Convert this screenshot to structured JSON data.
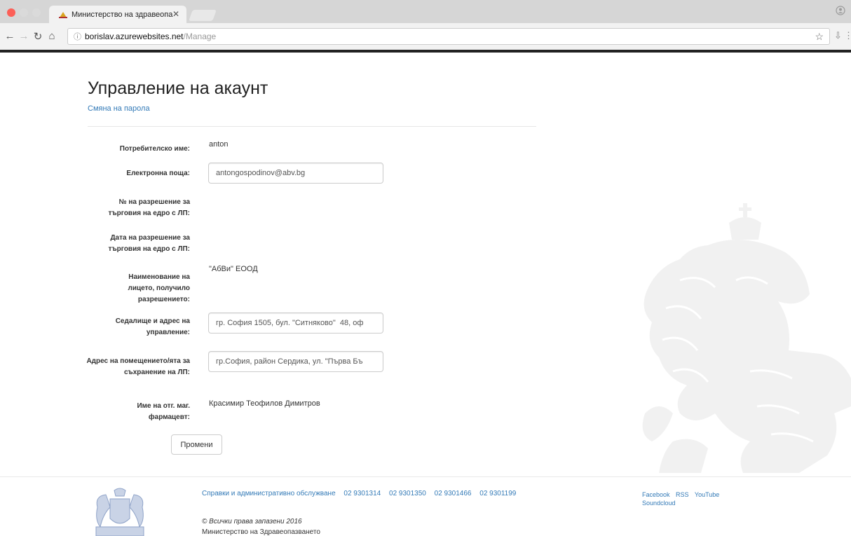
{
  "browser": {
    "tab_title": "Министерство на здравеопа",
    "url_host": "borislav.azurewebsites.net",
    "url_path": "/Manage"
  },
  "page": {
    "title": "Управление на акаунт",
    "change_password_link": "Смяна на парола"
  },
  "form": {
    "username_label": "Потребителско име:",
    "username_value": "anton",
    "email_label": "Електронна поща:",
    "email_value": "antongospodinov@abv.bg",
    "permit_no_label": "№ на разрешение за търговия на едро с ЛП:",
    "permit_date_label": "Дата на разрешение за търговия на едро с ЛП:",
    "entity_name_label": "Наименование на лицето, получило разрешението:",
    "entity_name_value": "\"АбВи\" ЕООД",
    "seat_address_label": "Седалище и адрес на управление:",
    "seat_address_value": "гр. София 1505, бул. \"Ситняково\"  48, оф",
    "storage_address_label": "Адрес на помещението/ята за съхранение на ЛП:",
    "storage_address_value": "гр.София, район Сердика, ул. \"Първа Бъ",
    "pharmacist_label": "Име на отг. маг. фармацевт:",
    "pharmacist_value": "Красимир Теофилов Димитров",
    "submit_label": "Промени"
  },
  "footer": {
    "info_links": [
      "Справки и административно обслужване",
      "02 9301314",
      "02 9301350",
      "02 9301466",
      "02 9301199"
    ],
    "copyright": "© Всички права запазени 2016",
    "ministry": "Министерство на Здравеопазването",
    "social": [
      "Facebook",
      "RSS",
      "YouTube",
      "Soundcloud"
    ]
  },
  "colors": {
    "link": "#337ab7",
    "watermark": "#f0f0f0"
  }
}
